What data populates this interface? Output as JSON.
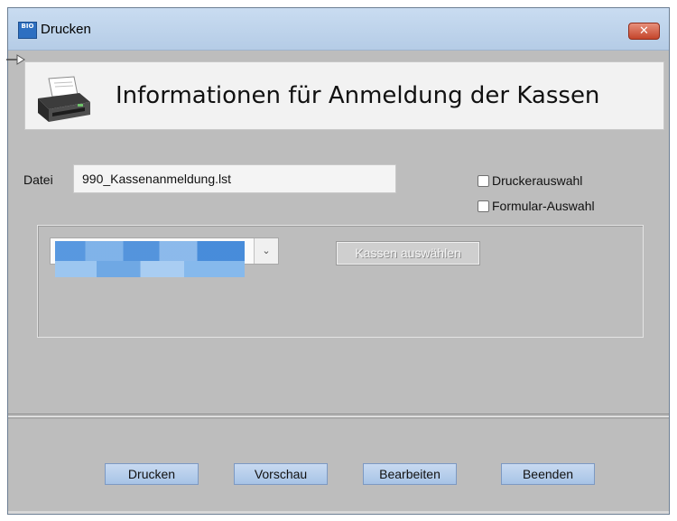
{
  "window": {
    "title": "Drucken",
    "app_icon_text": "BIO",
    "close_symbol": "✕"
  },
  "banner": {
    "title": "Informationen für Anmeldung der Kassen",
    "icon": "printer-icon"
  },
  "file": {
    "label": "Datei",
    "value": "990_Kassenanmeldung.lst"
  },
  "options": {
    "printer_select": {
      "label": "Druckerauswahl",
      "checked": false
    },
    "form_select": {
      "label": "Formular-Auswahl",
      "checked": false
    }
  },
  "selection": {
    "combo_arrow": "⌄",
    "select_registers_label": "Kassen auswählen"
  },
  "buttons": {
    "print": "Drucken",
    "preview": "Vorschau",
    "edit": "Bearbeiten",
    "exit": "Beenden"
  },
  "colors": {
    "dialog_background": "#bdbdbd",
    "titlebar": "#c0d6ef",
    "close_button": "#c4452b",
    "button_blue": "#b6cdec"
  }
}
